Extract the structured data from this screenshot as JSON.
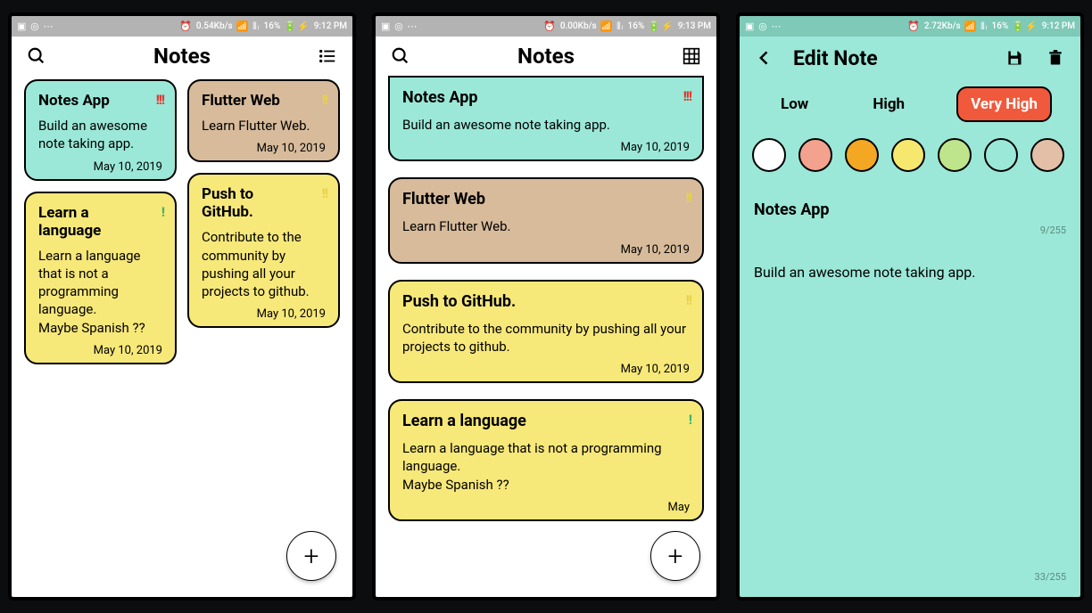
{
  "status": {
    "left_icons": "▣ ◎ ⋯",
    "rate_a": "0.54Kb/s",
    "rate_b": "0.00Kb/s",
    "rate_c": "2.72Kb/s",
    "signal": "⏰ 📶 ᴴᴳ ⫴ₗ",
    "battery_pct": "16%",
    "battery": "🔋⚡",
    "time_a": "9:12 PM",
    "time_b": "9:13 PM",
    "time_c": "9:12 PM"
  },
  "screen_grid": {
    "title": "Notes",
    "plus": "+"
  },
  "screen_list": {
    "title": "Notes",
    "plus": "+"
  },
  "notes": {
    "n1": {
      "title": "Notes App",
      "body": "Build an awesome note taking app.",
      "date": "May 10, 2019",
      "mark": "!!!"
    },
    "n2": {
      "title": "Flutter Web",
      "body": "Learn Flutter Web.",
      "date": "May 10, 2019",
      "mark": "!!"
    },
    "n3": {
      "title": "Learn a language",
      "body": "Learn a language that is not a programming language.\nMaybe Spanish ??",
      "date": "May 10, 2019",
      "mark": "!"
    },
    "n4": {
      "title": "Push to GitHub.",
      "body": "Contribute to the community by pushing all your projects to github.",
      "date": "May 10, 2019",
      "mark": "!!"
    }
  },
  "list_n4_date_cut": "May",
  "edit": {
    "title": "Edit Note",
    "prio_low": "Low",
    "prio_high": "High",
    "prio_vhigh": "Very High",
    "colors": [
      "#ffffff",
      "#f3a28e",
      "#f4a722",
      "#f6e86e",
      "#bfe58c",
      "#9be8d8",
      "#e2bfa6"
    ],
    "field_title": "Notes App",
    "title_count": "9/255",
    "field_body": "Build an awesome note taking app.",
    "body_count": "33/255"
  }
}
